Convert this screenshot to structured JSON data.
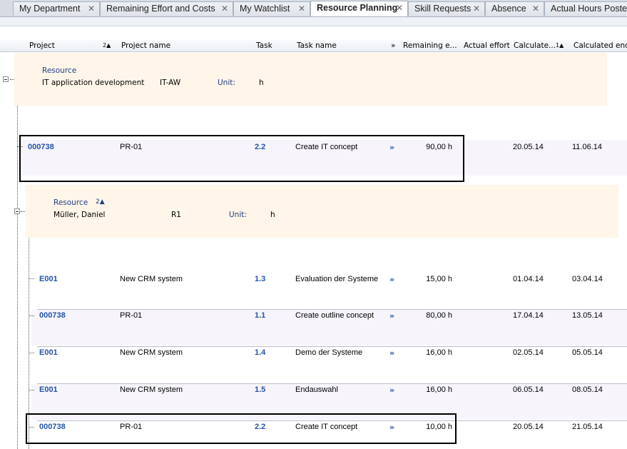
{
  "tabs": [
    {
      "label": "My Department",
      "close": "✕"
    },
    {
      "label": "Remaining Effort and Costs",
      "close": "✕"
    },
    {
      "label": "My Watchlist",
      "close": "✕"
    },
    {
      "label": "Resource Planning",
      "close": "✕"
    },
    {
      "label": "Skill Requests",
      "close": "✕"
    },
    {
      "label": "Absence",
      "close": "✕"
    },
    {
      "label": "Actual Hours Posted"
    }
  ],
  "columns": {
    "project": "Project",
    "project_sort": "2▲",
    "project_name": "Project name",
    "task": "Task",
    "task_name": "Task name",
    "expand": "»",
    "remaining": "Remaining e...",
    "actual": "Actual effort",
    "calc_start": "Calculate...",
    "calc_start_sort": "1▲",
    "calc_end": "Calculated end"
  },
  "groups": [
    {
      "label": "Resource",
      "name": "IT application development",
      "id": "IT-AW",
      "unit_label": "Unit:",
      "unit": "h"
    },
    {
      "label": "Resource",
      "sort": "2▲",
      "name": "Müller, Daniel",
      "id": "R1",
      "unit_label": "Unit:",
      "unit": "h"
    }
  ],
  "rows": [
    {
      "project": "000738",
      "project_name": "PR-01",
      "task": "2.2",
      "task_name": "Create IT concept",
      "arrow": "»",
      "remaining": "90,00 h",
      "start": "20.05.14",
      "end": "11.06.14"
    },
    {
      "project": "E001",
      "project_name": "New CRM system",
      "task": "1.3",
      "task_name": "Evaluation der Systeme",
      "arrow": "»",
      "remaining": "15,00 h",
      "start": "01.04.14",
      "end": "03.04.14"
    },
    {
      "project": "000738",
      "project_name": "PR-01",
      "task": "1.1",
      "task_name": "Create outline concept",
      "arrow": "»",
      "remaining": "80,00 h",
      "start": "17.04.14",
      "end": "13.05.14"
    },
    {
      "project": "E001",
      "project_name": "New CRM system",
      "task": "1.4",
      "task_name": "Demo der Systeme",
      "arrow": "»",
      "remaining": "16,00 h",
      "start": "02.05.14",
      "end": "05.05.14"
    },
    {
      "project": "E001",
      "project_name": "New CRM system",
      "task": "1.5",
      "task_name": "Endauswahl",
      "arrow": "»",
      "remaining": "16,00 h",
      "start": "06.05.14",
      "end": "08.05.14"
    },
    {
      "project": "000738",
      "project_name": "PR-01",
      "task": "2.2",
      "task_name": "Create IT concept",
      "arrow": "»",
      "remaining": "10,00 h",
      "start": "20.05.14",
      "end": "21.05.14"
    }
  ],
  "colors": {
    "accent_blue": "#2354a5",
    "group_bg": "#fff5e9",
    "row_alt": "#f7f5fb"
  }
}
